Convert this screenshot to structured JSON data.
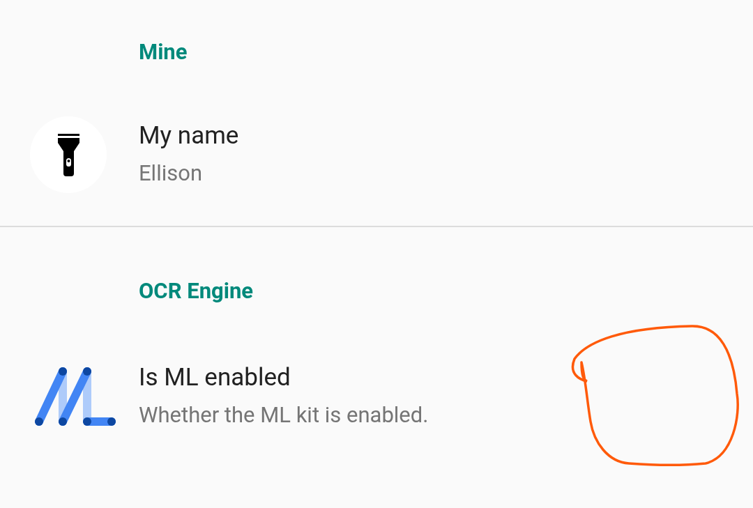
{
  "categories": [
    {
      "title": "Mine",
      "items": [
        {
          "kind": "flashlight",
          "title": "My name",
          "summary": "Ellison"
        }
      ]
    },
    {
      "title": "OCR Engine",
      "items": [
        {
          "kind": "ml",
          "title": "Is ML enabled",
          "summary": "Whether the ML kit is enabled."
        }
      ]
    }
  ]
}
